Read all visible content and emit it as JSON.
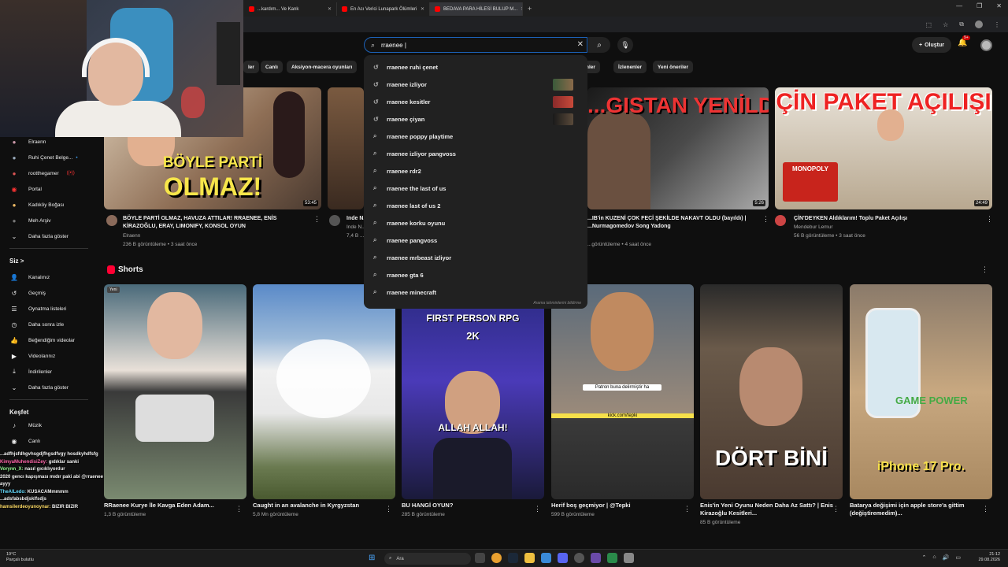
{
  "browser": {
    "tabs": [
      {
        "title": "...kardım... Ve Kank"
      },
      {
        "title": "En Acı Verici Lunapark Ölümleri"
      },
      {
        "title": "BEDAVA PARA HİLESİ BULUP M..."
      }
    ],
    "new_tab": "+"
  },
  "header": {
    "search_value": "rraenee |",
    "create_label": "Oluştur",
    "notif_count": "9+"
  },
  "chips": [
    "ler",
    "Canlı",
    "Aksiyon-macera oyunları",
    "...enler",
    "İzlenenler",
    "Yeni öneriler"
  ],
  "suggestions": {
    "items": [
      {
        "text": "rraenee ruhi çenet",
        "icon": "history"
      },
      {
        "text": "rraenee izliyor",
        "icon": "history"
      },
      {
        "text": "rraenee kesitler",
        "icon": "history"
      },
      {
        "text": "rraenee çiyan",
        "icon": "history"
      },
      {
        "text": "rraenee poppy playtime",
        "icon": "search"
      },
      {
        "text": "rraenee izliyor pangvoss",
        "icon": "search"
      },
      {
        "text": "rraenee rdr2",
        "icon": "search"
      },
      {
        "text": "rraenee the last of us",
        "icon": "search"
      },
      {
        "text": "rraenee last of us 2",
        "icon": "search"
      },
      {
        "text": "rraenee korku oyunu",
        "icon": "search"
      },
      {
        "text": "rraenee pangvoss",
        "icon": "search"
      },
      {
        "text": "rraenee mrbeast izliyor",
        "icon": "search"
      },
      {
        "text": "rraenee gta 6",
        "icon": "search"
      },
      {
        "text": "rraenee minecraft",
        "icon": "search"
      }
    ],
    "footer": "Arama tahminlerini bildirme"
  },
  "sidebar": {
    "subs": [
      {
        "label": "Elraenn"
      },
      {
        "label": "Ruhi Çenet Belge..."
      },
      {
        "label": "rootthegamer"
      },
      {
        "label": "Portal"
      },
      {
        "label": "Kadıköy Boğası"
      },
      {
        "label": "Meh Arşiv"
      },
      {
        "label": "Daha fazla göster"
      }
    ],
    "you_head": "Siz",
    "you_chev": ">",
    "you": [
      {
        "label": "Kanalınız"
      },
      {
        "label": "Geçmiş"
      },
      {
        "label": "Oynatma listeleri"
      },
      {
        "label": "Daha sonra izle"
      },
      {
        "label": "Beğendiğim videolar"
      },
      {
        "label": "Videolarınız"
      },
      {
        "label": "İndirilenler"
      },
      {
        "label": "Daha fazla göster"
      }
    ],
    "explore_head": "Keşfet",
    "explore": [
      {
        "label": "Müzik"
      },
      {
        "label": "Canlı"
      }
    ]
  },
  "videos": [
    {
      "title": "BÖYLE PARTİ OLMAZ, HAVUZA ATTILAR! RRAENEE, ENİS KİRAZOĞLU, ERAY, LIMONIFY, KONSOL OYUN",
      "channel": "Elraenn",
      "meta": "236 B görüntüleme • 3 saat önce",
      "duration": "53:45",
      "thumb_text_1": "BÖYLE PARTİ",
      "thumb_text_2": "OLMAZ!"
    },
    {
      "title": "Inde N...",
      "channel": "Inde N...",
      "meta": "7,4 B ...",
      "duration": ""
    },
    {
      "title": "...IB'in KUZENİ ÇOK FECİ ŞEKİLDE NAKAVT OLDU (bayıldı) | ...Nurmagomedov Song Yadong",
      "channel": "...",
      "meta": "...görüntüleme • 4 saat önce",
      "duration": "5:26",
      "thumb_text_1": "...GISTAN YENİLDİ"
    },
    {
      "title": "ÇİN'DEYKEN Aldıklarım! Toplu Paket Açılışı",
      "channel": "Mendebur Lemur",
      "meta": "56 B görüntüleme • 3 saat önce",
      "duration": "24:49",
      "thumb_text_1": "ÇİN PAKET AÇILIŞI",
      "thumb_text_2": "MONOPOLY"
    }
  ],
  "shorts": {
    "heading": "Shorts",
    "items": [
      {
        "title": "RRaenee Kurye İle Kavga Eden Adam...",
        "views": "1,3 B görüntüleme",
        "badge": "Yeni"
      },
      {
        "title": "Caught in an avalanche in Kyrgyzstan",
        "views": "5,8 Mn görüntüleme"
      },
      {
        "title": "BU HANGİ OYUN?",
        "views": "285 B görüntüleme",
        "overlay_1": "FIRST PERSON RPG",
        "overlay_2": "2K",
        "overlay_3": "ALLAH ALLAH!"
      },
      {
        "title": "Herif boş geçmiyor | @Tepki",
        "views": "599 B görüntüleme",
        "overlay_1": "Patron buna delirmiştir ha",
        "overlay_2": "kick.com/tepki"
      },
      {
        "title": "Enis'in Yeni Oyunu Neden Daha Az Sattı? | Enis Kirazoğlu Kesitleri...",
        "views": "85 B görüntüleme",
        "overlay_1": "DÖRT BİNİ"
      },
      {
        "title": "Batarya değişimi için apple store'a gittim (değiştiremedim)...",
        "views": "",
        "overlay_1": "iPhone 17 Pro.",
        "overlay_2": "GAME POWER"
      }
    ]
  },
  "chat": [
    {
      "user": "",
      "msg": "...adfhjsfdhgvhsgdjfhgsdfvgy hosdkyhdfsfg",
      "color": "#7cf"
    },
    {
      "user": "KimyaMuhendisiZey:",
      "msg": "gıdıklar sanki",
      "color": "#f6a"
    },
    {
      "user": "Vorynn_X:",
      "msg": "nasıl gıcıklıyordur",
      "color": "#9f9"
    },
    {
      "user": "",
      "msg": "2020 gencı kapışması mıdır paki abi @rraenee",
      "color": "#fc6"
    },
    {
      "user": "",
      "msg": "ayyy",
      "color": "#ccc"
    },
    {
      "user": "TheAlLedo:",
      "msg": "KUSACAMmmmm",
      "color": "#6df"
    },
    {
      "user": "",
      "msg": "...adsfabsbdjsklfsdjs",
      "color": "#ccc"
    },
    {
      "user": "hamsilerdeoyunoynar:",
      "msg": "BIZIR BIZIR",
      "color": "#fd6"
    }
  ],
  "taskbar": {
    "weather_temp": "19°C",
    "weather_desc": "Parçalı bulutlu",
    "search": "Ara",
    "time": "21:12",
    "date": "29.08.2026"
  },
  "colors": {
    "accent": "#ff0033",
    "bg": "#0f0f0f",
    "search_focus": "#1c62b9"
  }
}
